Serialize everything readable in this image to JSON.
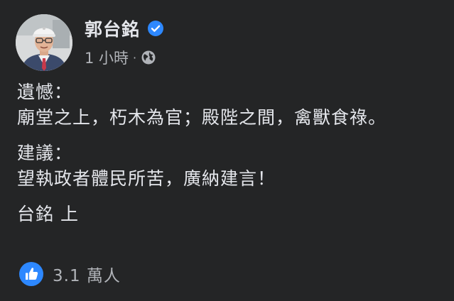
{
  "post": {
    "author": {
      "name": "郭台銘",
      "verified": true
    },
    "meta": {
      "time": "1 小時",
      "separator": "·",
      "audience_icon": "globe-icon"
    },
    "paragraphs": [
      {
        "lines": [
          "遺憾：",
          "廟堂之上，朽木為官；殿陛之間，禽獸食祿。"
        ]
      },
      {
        "lines": [
          "建議：",
          "望執政者體民所苦，廣納建言！"
        ]
      },
      {
        "lines": [
          "台銘 上"
        ]
      }
    ],
    "reactions": {
      "icon": "like-icon",
      "count": "3.1 萬人"
    }
  },
  "colors": {
    "background": "#242526",
    "primary_text": "#e4e6eb",
    "secondary_text": "#b0b3b8",
    "accent": "#2d88ff"
  }
}
